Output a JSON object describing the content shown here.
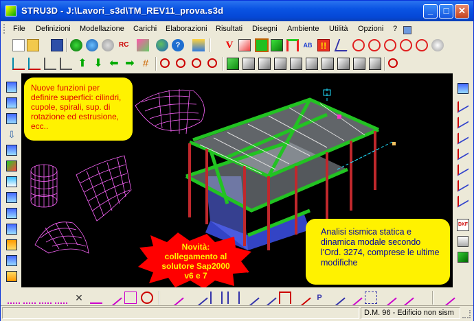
{
  "window": {
    "title": "STRU3D - J:\\Lavori_s3d\\TM_REV11_prova.s3d"
  },
  "menu": [
    "File",
    "Definizioni",
    "Modellazione",
    "Carichi",
    "Elaborazioni",
    "Risultati",
    "Disegni",
    "Ambiente",
    "Utilità",
    "Opzioni",
    "?"
  ],
  "toolbar": {
    "rc_label": "RC",
    "v_label": "V",
    "ab_label": "AB",
    "exclaim_label": "!!"
  },
  "callouts": {
    "surfaces": "Nuove funzioni per definire superfici: cilindri, cupole, spirali, sup. di rotazione ed estrusione, ecc..",
    "seismic": "Analisi sismica statica e dinamica modale secondo l'Ord. 3274, comprese le ultime modifiche",
    "novita": "Novità: collegamento al solutore Sap2000 v6 e 7"
  },
  "right_sidebar": {
    "dxf_label": "DXF"
  },
  "status": {
    "norm": "D.M. 96 - Edificio non sism"
  },
  "colors": {
    "titlebar": "#0A54E3",
    "canvas": "#000000",
    "callout_bg": "#FFF200",
    "callout_red": "#E00000",
    "callout_blue": "#0000A8",
    "burst": "#FF0000",
    "structure_green": "#22C322",
    "wireframe": "#FF66FF"
  }
}
